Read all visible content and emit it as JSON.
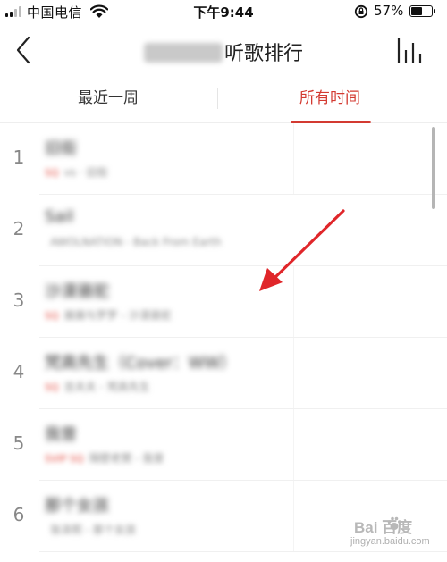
{
  "status_bar": {
    "carrier": "中国电信",
    "time": "下午9:44",
    "battery_percent": "57%",
    "battery_level": 0.57
  },
  "nav": {
    "title_suffix": "听歌排行",
    "back_icon": "chevron-left-icon",
    "chart_icon": "bar-chart-icon"
  },
  "tabs": [
    {
      "label": "最近一周",
      "active": false
    },
    {
      "label": "所有时间",
      "active": true
    }
  ],
  "colors": {
    "accent": "#d33a31",
    "rank_text": "#888888",
    "badge": "#e2483d"
  },
  "songs": [
    {
      "rank": "1",
      "title": "旧街",
      "badge": "SQ",
      "subtitle": "vs · 旧街"
    },
    {
      "rank": "2",
      "title": "Sail",
      "badge": "",
      "subtitle": "AWOLNATION - Back From Earth"
    },
    {
      "rank": "3",
      "title": "沙漠骆驼",
      "badge": "SQ",
      "subtitle": "展展与罗罗 - 沙漠骆驼"
    },
    {
      "rank": "4",
      "title": "梵高先生（Cover：WW）",
      "badge": "SQ",
      "subtitle": "吉夫夫 - 梵高先生"
    },
    {
      "rank": "5",
      "title": "我曾",
      "badge": "SVIP SQ",
      "subtitle": "隔壁老樊 - 我曾"
    },
    {
      "rank": "6",
      "title": "那个女孩",
      "badge": "",
      "subtitle": "张泽熙 - 那个女孩"
    }
  ],
  "watermark": {
    "brand": "Bai  百度",
    "url": "jingyan.baidu.com"
  }
}
